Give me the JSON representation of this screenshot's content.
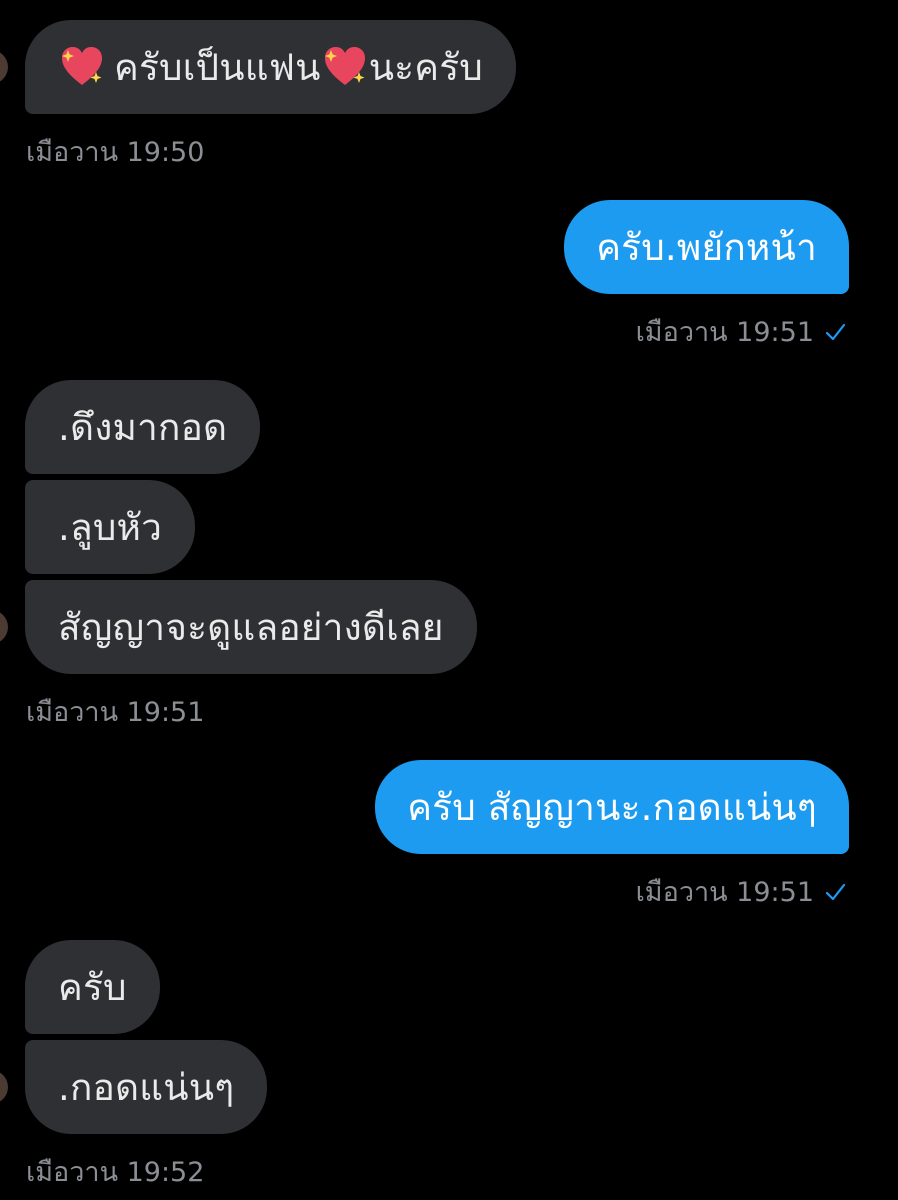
{
  "conversation": {
    "messages": [
      {
        "id": "m1",
        "side": "in",
        "segments": [
          "ครับเป็นแฟน",
          "นะครับ"
        ],
        "emoji": [
          "sparkling-heart",
          "sparkling-heart"
        ],
        "timestamp": "เมือวาน 19:50"
      },
      {
        "id": "m2",
        "side": "out",
        "text": "ครับ.พยักหน้า",
        "timestamp": "เมือวาน 19:51",
        "read": true
      },
      {
        "id": "m3",
        "side": "in",
        "group": [
          ".ดึงมากอด",
          ".ลูบหัว",
          "สัญญาจะดูแลอย่างดีเลย"
        ],
        "timestamp": "เมือวาน 19:51"
      },
      {
        "id": "m4",
        "side": "out",
        "text": "ครับ สัญญานะ.กอดแน่นๆ",
        "timestamp": "เมือวาน 19:51",
        "read": true
      },
      {
        "id": "m5",
        "side": "in",
        "group": [
          "ครับ",
          ".กอดแน่นๆ"
        ],
        "timestamp": "เมือวาน 19:52"
      }
    ]
  },
  "icons": {
    "read_receipt": "checkmark-icon",
    "emoji": "sparkling-heart-icon"
  },
  "colors": {
    "background": "#000000",
    "incoming_bubble": "#2f3033",
    "outgoing_bubble": "#1d9bf0",
    "timestamp": "#8b8f95",
    "read_check": "#1d9bf0"
  }
}
